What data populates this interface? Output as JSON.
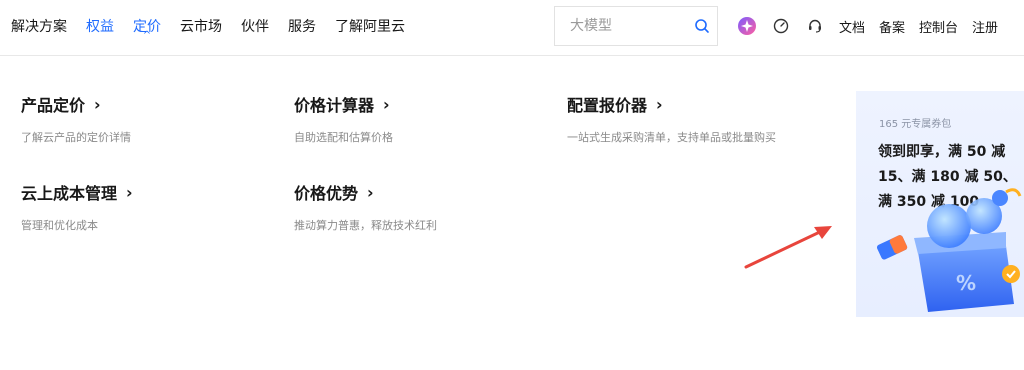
{
  "nav": {
    "items": [
      {
        "label": "解决方案",
        "active": false
      },
      {
        "label": "权益",
        "active": false,
        "accent": true
      },
      {
        "label": "定价",
        "active": true,
        "accent": true
      },
      {
        "label": "云市场",
        "active": false
      },
      {
        "label": "伙伴",
        "active": false
      },
      {
        "label": "服务",
        "active": false
      },
      {
        "label": "了解阿里云",
        "active": false
      }
    ],
    "caret": "^"
  },
  "search": {
    "placeholder": "大模型"
  },
  "tools": {
    "docs": "文档",
    "filing": "备案",
    "console": "控制台",
    "register": "注册"
  },
  "menu": {
    "chevron": "›",
    "items": [
      {
        "title": "产品定价",
        "desc": "了解云产品的定价详情"
      },
      {
        "title": "价格计算器",
        "desc": "自助选配和估算价格"
      },
      {
        "title": "配置报价器",
        "desc": "一站式生成采购清单，支持单品或批量购买"
      },
      {
        "title": "云上成本管理",
        "desc": "管理和优化成本"
      },
      {
        "title": "价格优势",
        "desc": "推动算力普惠，释放技术红利"
      }
    ]
  },
  "promo": {
    "tag": "165 元专属券包",
    "lines": [
      "领到即享，满 50 减",
      "15、满 180 减 50、",
      "满 350 减 100"
    ]
  },
  "colors": {
    "accent": "#1f6bff",
    "arrow": "#e8453c"
  }
}
